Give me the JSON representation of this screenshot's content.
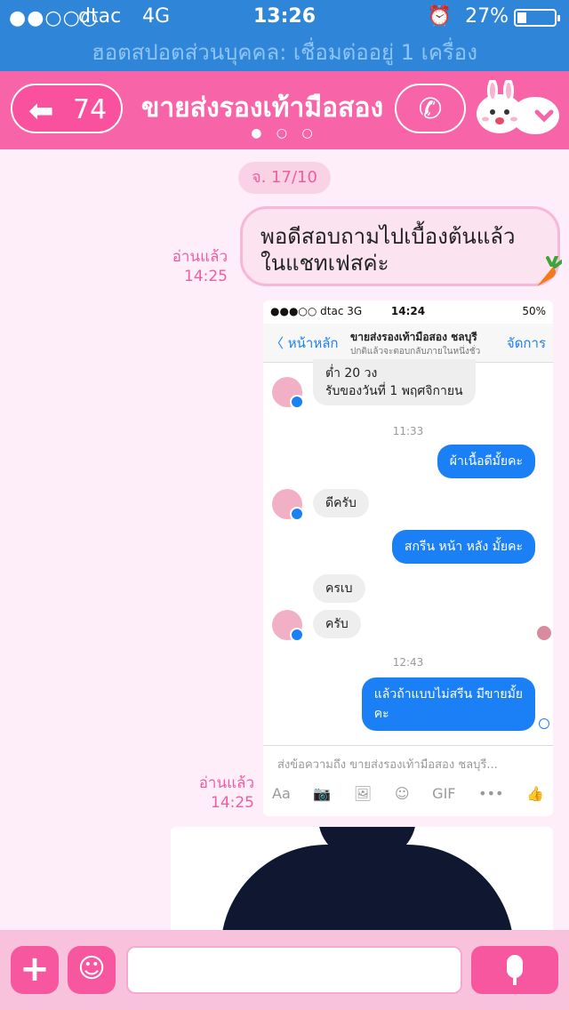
{
  "status_bar": {
    "signal": "●●○○○",
    "carrier": "dtac",
    "network": "4G",
    "time": "13:26",
    "battery": "27%"
  },
  "hotspot_banner": "ฮอตสปอตส่วนบุคคล: เชื่อมต่ออยู่ 1 เครื่อง",
  "header": {
    "back_count": "74",
    "title": "ขายส่งรองเท้ามือสอง"
  },
  "chat": {
    "date": "จ. 17/10",
    "messages": [
      {
        "read": "อ่านแล้ว",
        "time": "14:25",
        "text_line1": "พอดีสอบถามไปเบื้องต้นแล้ว",
        "text_line2": "ในแชทเฟสค่ะ"
      },
      {
        "read": "อ่านแล้ว",
        "time": "14:25"
      }
    ]
  },
  "screenshot": {
    "status": {
      "left": "●●●○○ dtac   3G",
      "time": "14:24",
      "right": "50%"
    },
    "nav": {
      "back": "〈 หน้าหลัก",
      "title": "ขายส่งรองเท้ามือสอง ชลบุรี",
      "subtitle": "ปกติแล้วจะตอบกลับภายในหนึ่งชั่ว",
      "manage": "จัดการ"
    },
    "incoming_top_line1": "ต่ำ 20 วง",
    "incoming_top_line2": "รับของวันที่ 1 พฤศจิกายน",
    "time1": "11:33",
    "out1": "ผ้าเนื้อดีมั้ยคะ",
    "in1": "ดีครับ",
    "out2": "สกรีน หน้า หลัง มั้ยคะ",
    "in2": "ครเบ",
    "in3": "ครับ",
    "time2": "12:43",
    "out3_line1": "แล้วถ้าแบบไม่สรีน มีขายมั้ย",
    "out3_line2": "คะ",
    "compose_placeholder": "ส่งข้อความถึง ขายส่งรองเท้ามือสอง ชลบุรี...",
    "tools": [
      "Aa",
      "📷",
      "🖼",
      "☺",
      "GIF",
      "•••",
      "👍"
    ]
  }
}
